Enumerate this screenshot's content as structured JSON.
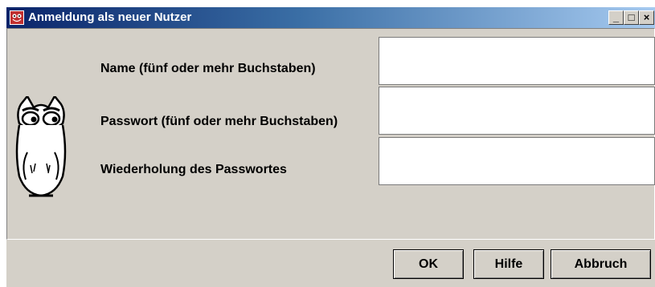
{
  "window": {
    "title": "Anmeldung als neuer Nutzer",
    "controls": {
      "minimize": "_",
      "maximize": "□",
      "close": "×"
    }
  },
  "form": {
    "name_label": "Name (fünf oder mehr Buchstaben)",
    "name_value": "",
    "password_label": "Passwort (fünf oder mehr Buchstaben)",
    "password_value": "",
    "repeat_label": "Wiederholung des Passwortes",
    "repeat_value": ""
  },
  "buttons": {
    "ok": "OK",
    "help": "Hilfe",
    "cancel": "Abbruch"
  },
  "icons": {
    "app": "owl-icon",
    "mascot": "owl-illustration"
  },
  "colors": {
    "titlebar_start": "#0a246a",
    "titlebar_end": "#a6caf0",
    "window_bg": "#d4d0c8"
  }
}
